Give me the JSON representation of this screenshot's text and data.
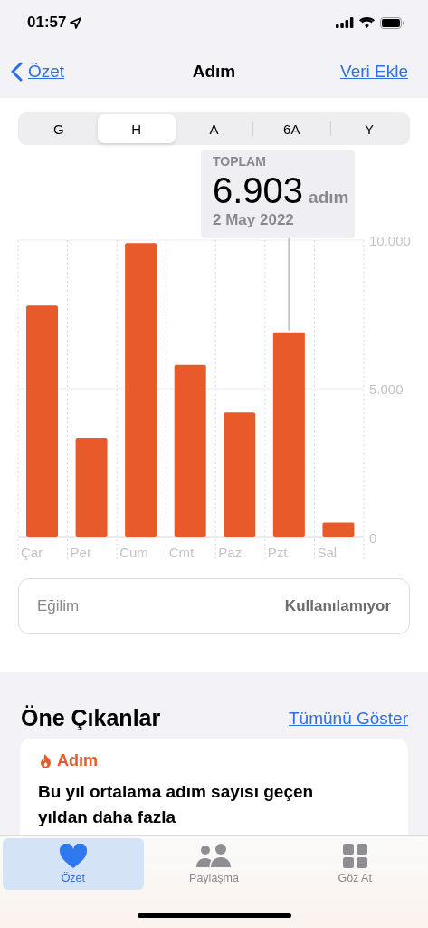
{
  "status_bar": {
    "time": "01:57"
  },
  "nav": {
    "back": "Özet",
    "title": "Adım",
    "action": "Veri Ekle"
  },
  "segments": [
    {
      "label": "G",
      "selected": false
    },
    {
      "label": "H",
      "selected": true
    },
    {
      "label": "A",
      "selected": false
    },
    {
      "label": "6A",
      "selected": false
    },
    {
      "label": "Y",
      "selected": false
    }
  ],
  "tooltip": {
    "label": "TOPLAM",
    "value": "6.903",
    "unit": "adım",
    "date": "2 May 2022"
  },
  "chart_data": {
    "type": "bar",
    "categories": [
      "Çar",
      "Per",
      "Cum",
      "Cmt",
      "Paz",
      "Pzt",
      "Sal"
    ],
    "series": [
      {
        "color": "#e95a2b",
        "values": [
          7800,
          3350,
          9900,
          5800,
          4200,
          6900,
          500
        ]
      }
    ],
    "ylim": [
      0,
      10000
    ],
    "yticks": [
      {
        "value": 0,
        "label": "0"
      },
      {
        "value": 5000,
        "label": "5.000"
      },
      {
        "value": 10000,
        "label": "10.000"
      }
    ],
    "annotations": [
      {
        "x": "Pzt"
      }
    ]
  },
  "trend": {
    "label": "Eğilim",
    "value": "Kullanılamıyor"
  },
  "highlights": {
    "title": "Öne Çıkanlar",
    "link": "Tümünü Göster",
    "card": {
      "category": "Adım",
      "text": "Bu yıl ortalama adım sayısı geçen yıldan daha fazla"
    }
  },
  "tab_bar": [
    {
      "label": "Özet",
      "selected": true
    },
    {
      "label": "Paylaşma",
      "selected": false
    },
    {
      "label": "Göz At",
      "selected": false
    }
  ]
}
